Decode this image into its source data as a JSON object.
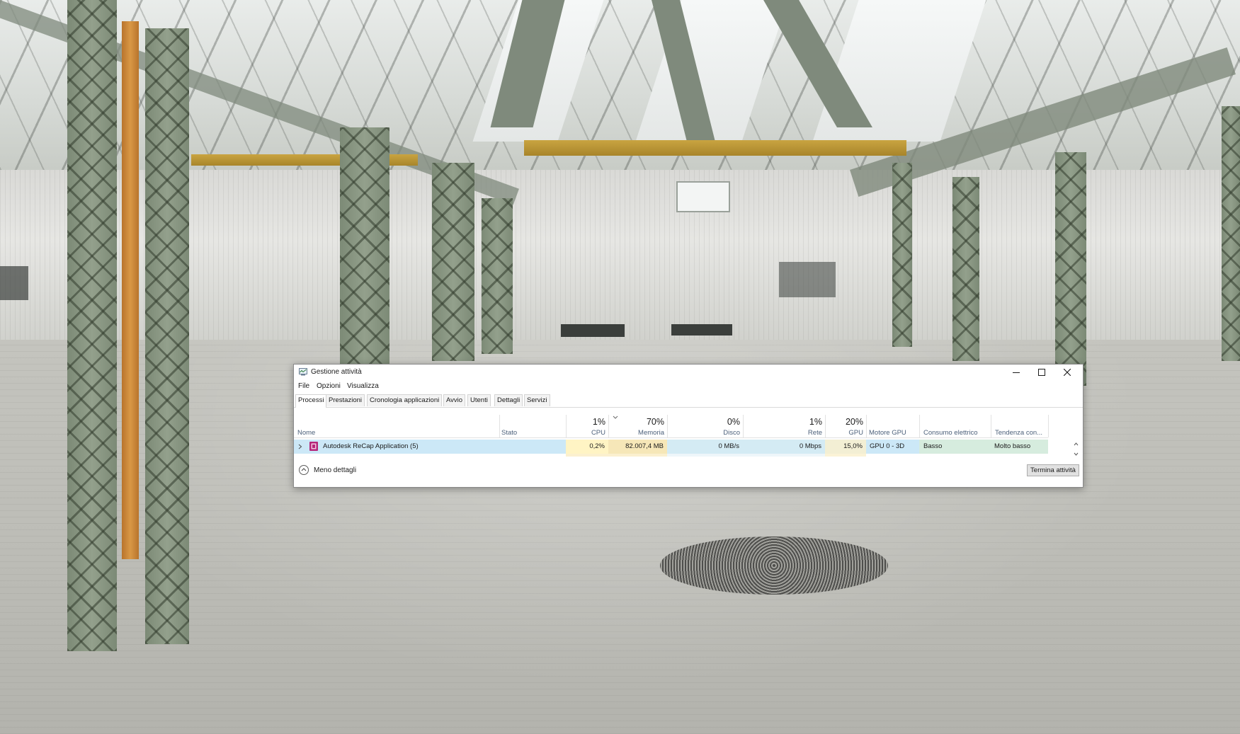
{
  "window": {
    "title": "Gestione attività",
    "controls": {
      "minimize": "minimize-icon",
      "maximize": "maximize-icon",
      "close": "close-icon"
    }
  },
  "menu": [
    "File",
    "Opzioni",
    "Visualizza"
  ],
  "tabs": [
    "Processi",
    "Prestazioni",
    "Cronologia applicazioni",
    "Avvio",
    "Utenti",
    "Dettagli",
    "Servizi"
  ],
  "active_tab": "Processi",
  "columns": {
    "name": {
      "label": "Nome"
    },
    "status": {
      "label": "Stato"
    },
    "cpu": {
      "label": "CPU",
      "percent": "1%"
    },
    "memory": {
      "label": "Memoria",
      "percent": "70%"
    },
    "disk": {
      "label": "Disco",
      "percent": "0%"
    },
    "network": {
      "label": "Rete",
      "percent": "1%"
    },
    "gpu": {
      "label": "GPU",
      "percent": "20%"
    },
    "gpu_engine": {
      "label": "Motore GPU"
    },
    "power": {
      "label": "Consumo elettrico"
    },
    "power_trend": {
      "label": "Tendenza con..."
    }
  },
  "process": {
    "name": "Autodesk ReCap Application (5)",
    "status": "",
    "cpu": "0,2%",
    "memory": "82.007,4 MB",
    "disk": "0 MB/s",
    "network": "0 Mbps",
    "gpu": "15,0%",
    "gpu_engine": "GPU 0 - 3D",
    "power": "Basso",
    "power_trend": "Molto basso"
  },
  "footer": {
    "less_details": "Meno dettagli",
    "end_task": "Termina attività"
  },
  "colors": {
    "selected_row": "#cce8f7",
    "memory_heat": "#f6e7b8",
    "cpu_heat": "#fff4c4",
    "header_label": "#4c607a",
    "app_icon": "#b5267a"
  }
}
